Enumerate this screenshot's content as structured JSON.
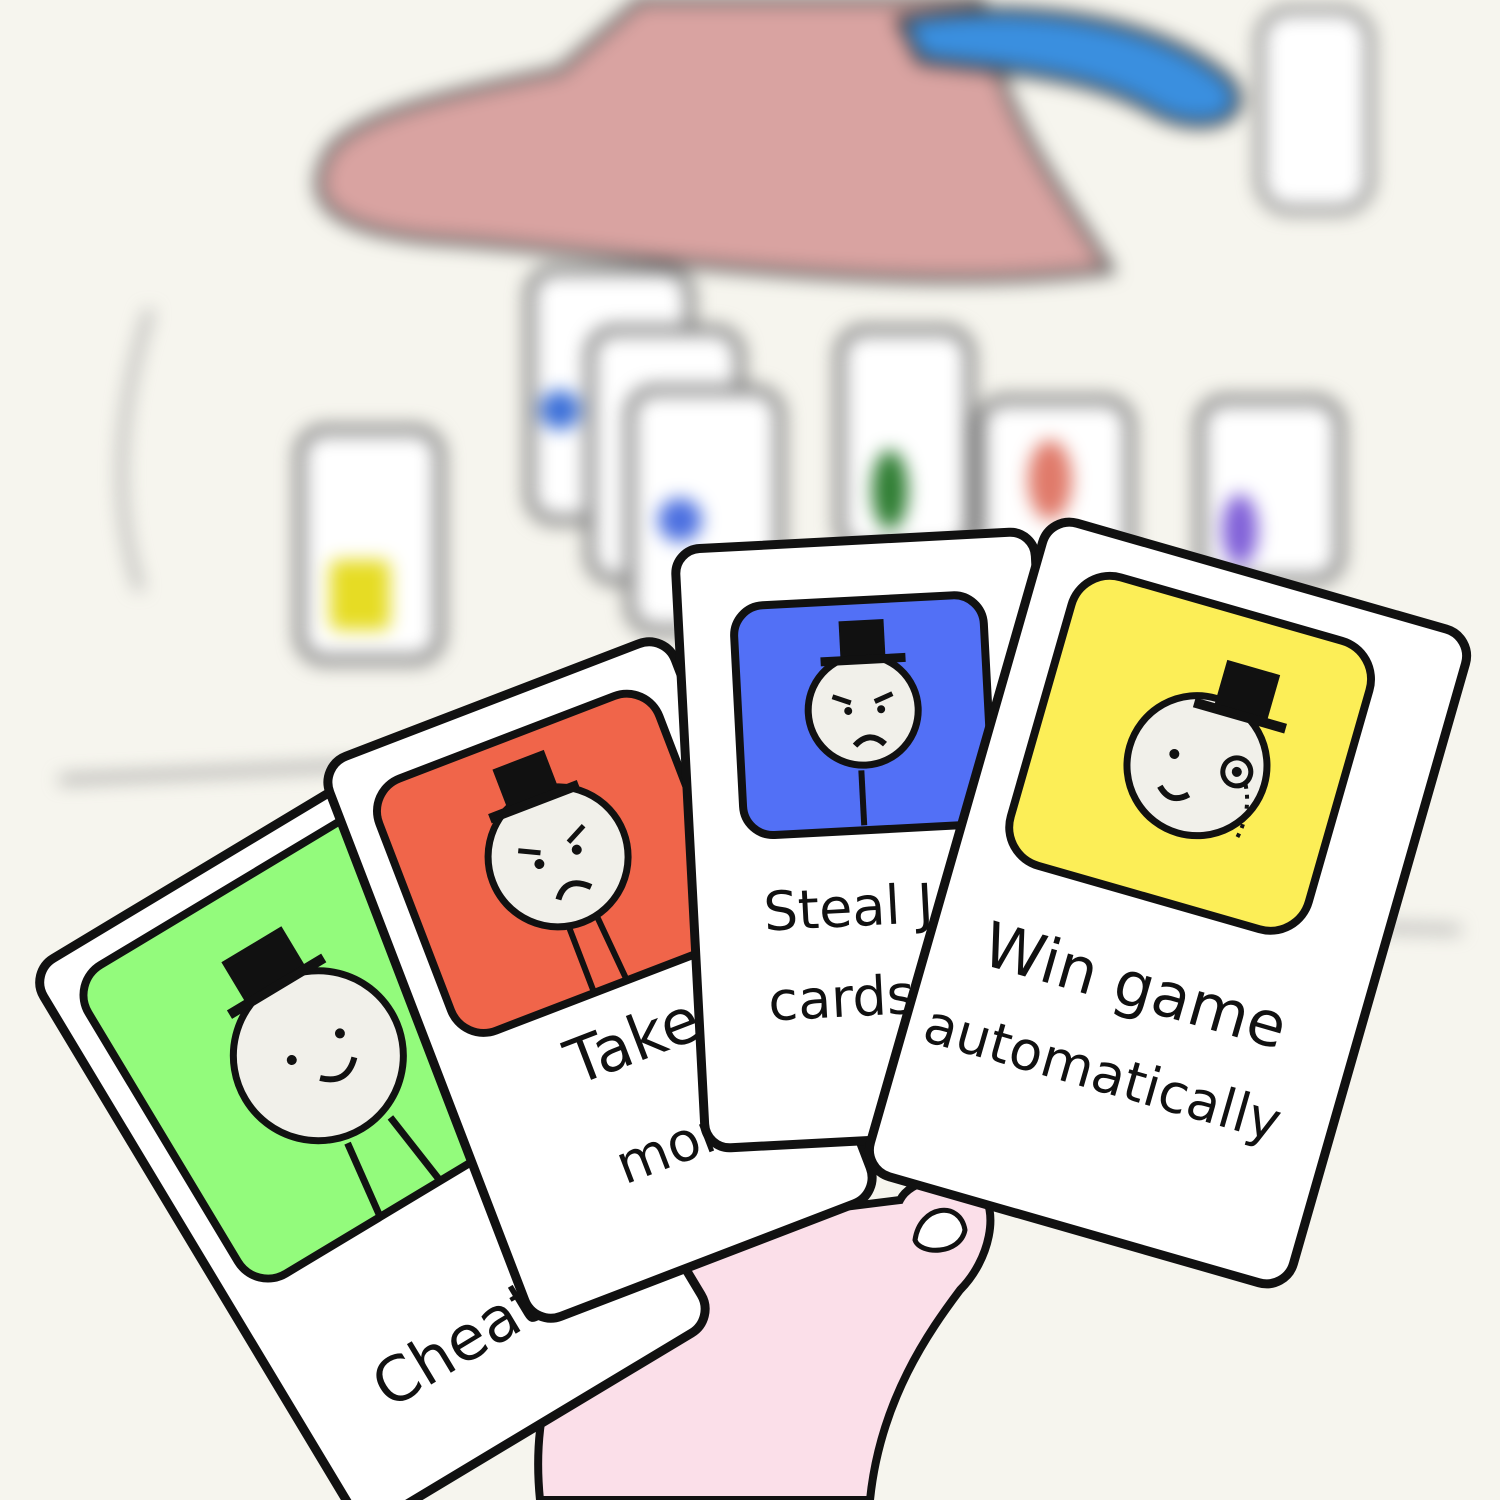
{
  "cards": [
    {
      "id": "cheat",
      "text": "Cheat",
      "color": "#93fb7c"
    },
    {
      "id": "take-money",
      "line1": "Take",
      "line2": "money",
      "color": "#f0654a"
    },
    {
      "id": "steal-cards",
      "line1": "Steal Jo",
      "line2": "cards",
      "color": "#5270f6"
    },
    {
      "id": "win-game",
      "line1": "Win game",
      "line2": "automatically",
      "color": "#fcee57"
    }
  ],
  "colors": {
    "background": "#f6f5ee",
    "hand": "#fbdfe9",
    "outline": "#111111",
    "hat_blur": "#d9a3a1",
    "blue_blur": "#3a8fdf"
  }
}
